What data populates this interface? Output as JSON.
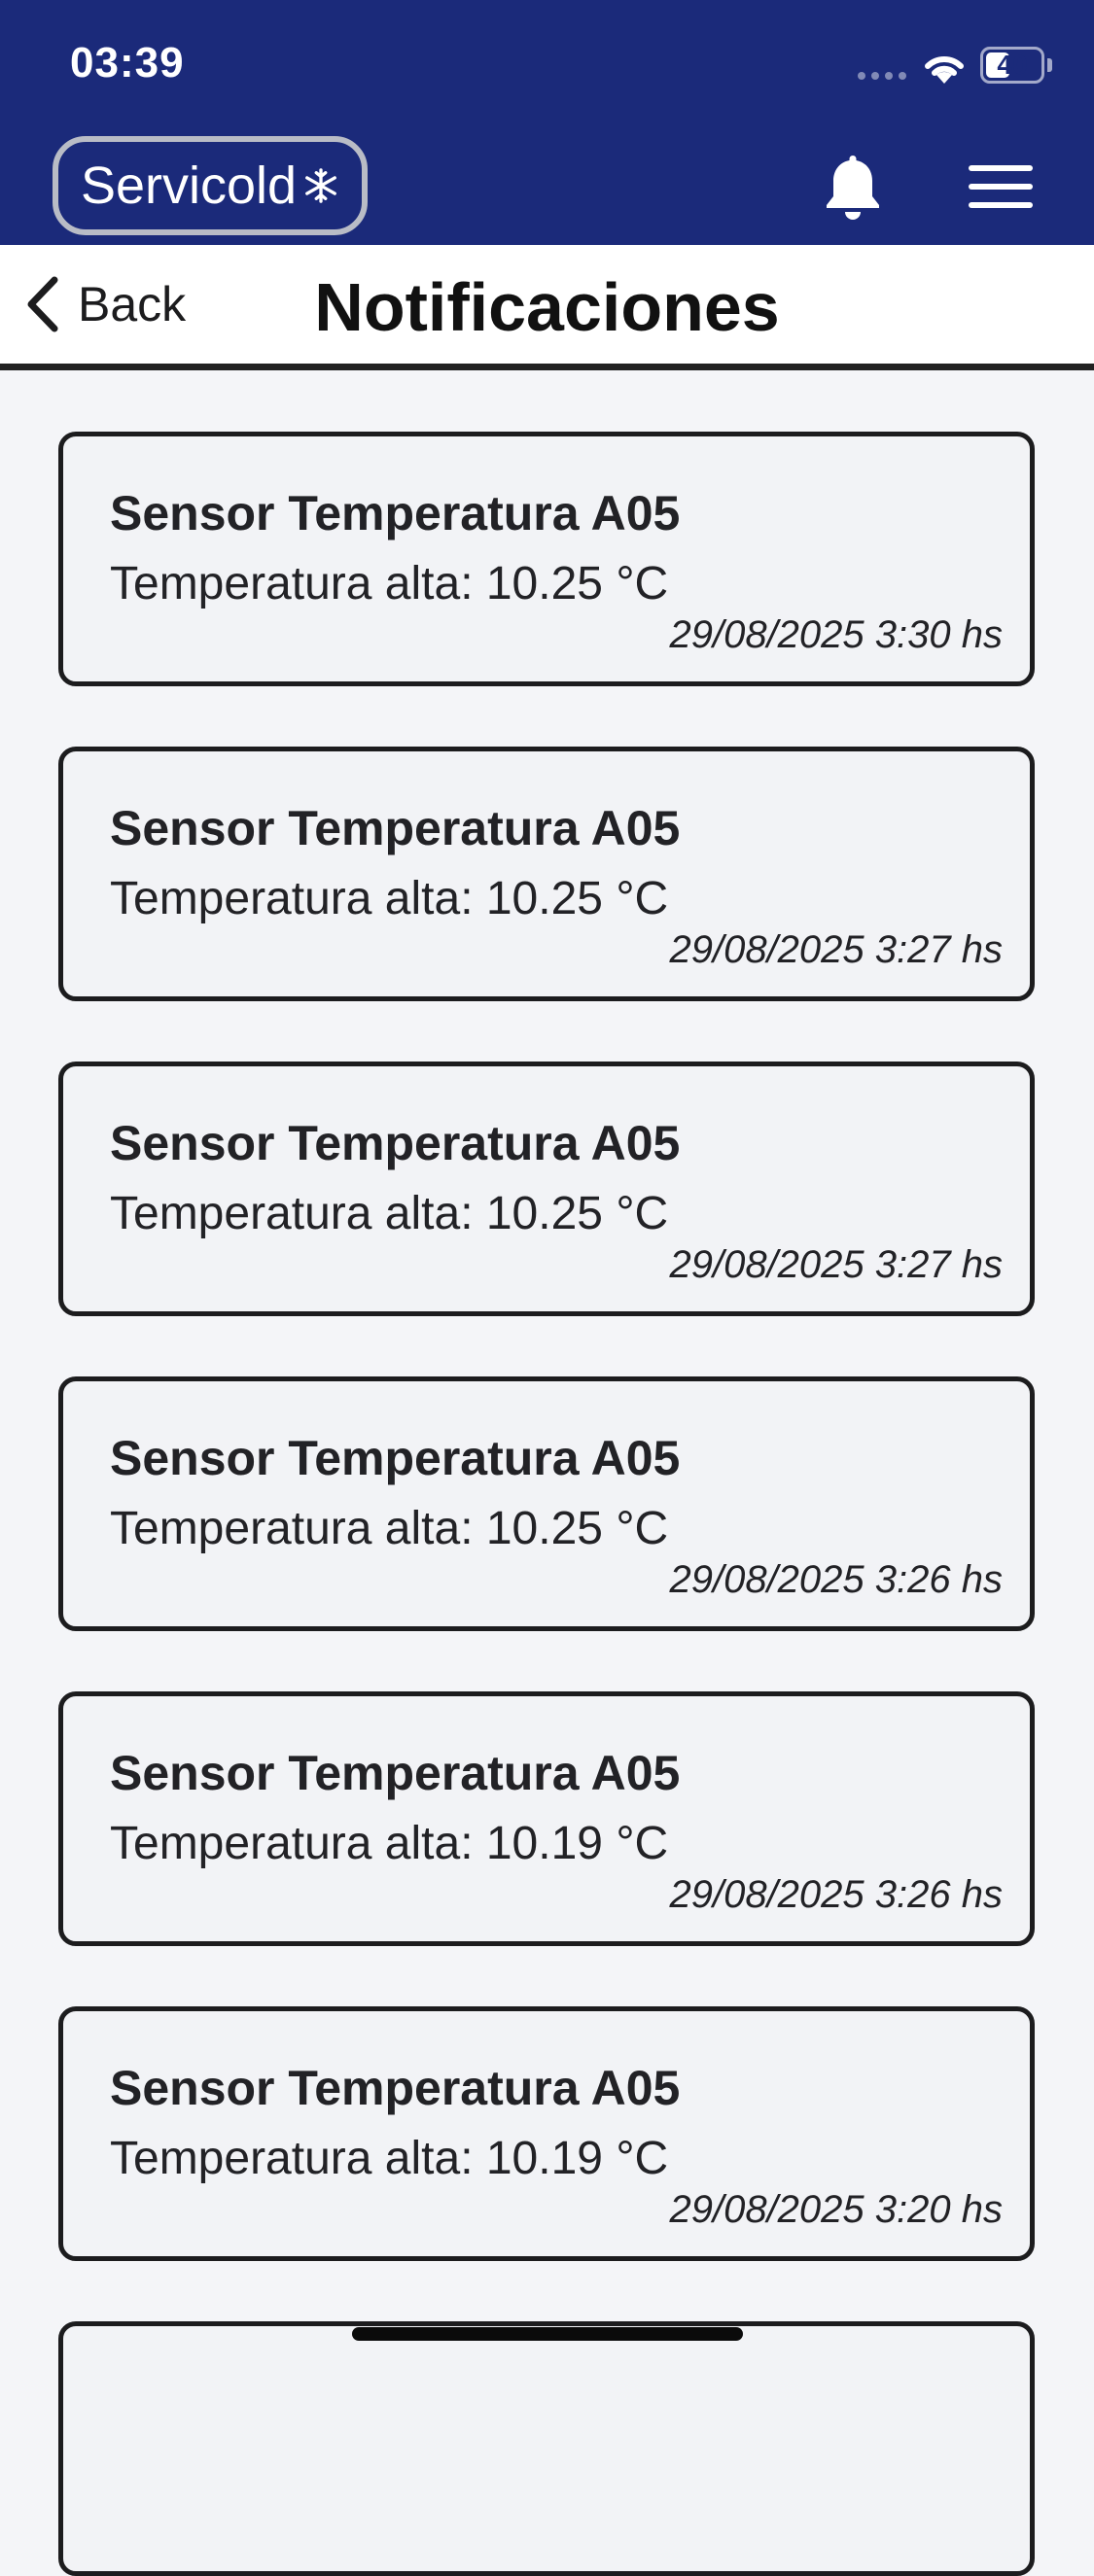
{
  "status_bar": {
    "time": "03:39",
    "battery_level": "40",
    "icons": [
      "cellular-signal-icon",
      "wifi-icon",
      "battery-icon"
    ]
  },
  "app_bar": {
    "logo_text": "Servicold",
    "logo_icon": "snowflake-icon",
    "actions": [
      "bell-icon",
      "menu-icon"
    ],
    "background_color": "#1b2a7a"
  },
  "nav": {
    "back_label": "Back",
    "title": "Notificaciones"
  },
  "notifications": [
    {
      "title": "Sensor Temperatura A05",
      "message": "Temperatura alta: 10.25 °C",
      "timestamp": "29/08/2025 3:30 hs"
    },
    {
      "title": "Sensor Temperatura A05",
      "message": "Temperatura alta: 10.25 °C",
      "timestamp": "29/08/2025 3:27 hs"
    },
    {
      "title": "Sensor Temperatura A05",
      "message": "Temperatura alta: 10.25 °C",
      "timestamp": "29/08/2025 3:27 hs"
    },
    {
      "title": "Sensor Temperatura A05",
      "message": "Temperatura alta: 10.25 °C",
      "timestamp": "29/08/2025 3:26 hs"
    },
    {
      "title": "Sensor Temperatura A05",
      "message": "Temperatura alta: 10.19 °C",
      "timestamp": "29/08/2025 3:26 hs"
    },
    {
      "title": "Sensor Temperatura A05",
      "message": "Temperatura alta: 10.19 °C",
      "timestamp": "29/08/2025 3:20 hs"
    },
    {
      "title": "",
      "message": "",
      "timestamp": ""
    }
  ]
}
